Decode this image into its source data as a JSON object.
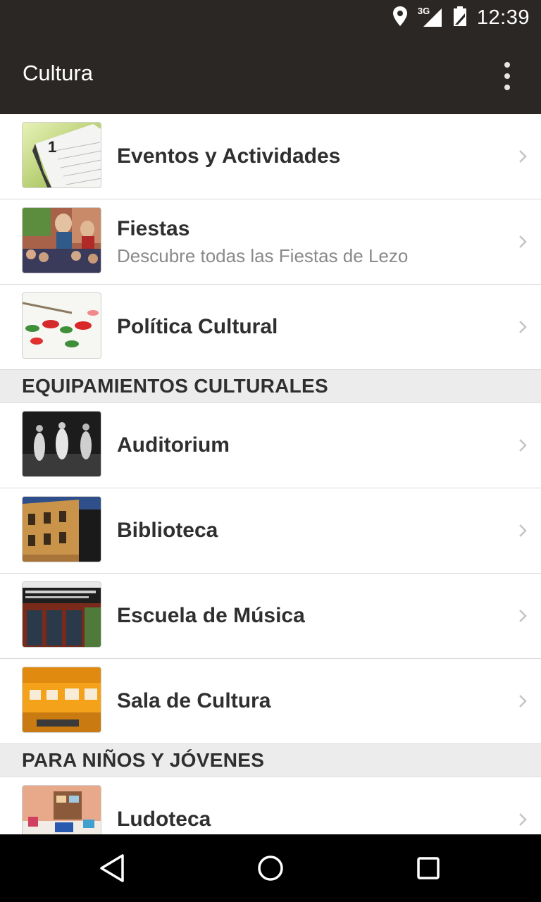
{
  "status_bar": {
    "time": "12:39",
    "network": "3G"
  },
  "app_bar": {
    "title": "Cultura",
    "menu_icon": "overflow-menu-icon"
  },
  "items": [
    {
      "title": "Eventos y Actividades",
      "subtitle": ""
    },
    {
      "title": "Fiestas",
      "subtitle": "Descubre todas las Fiestas de Lezo"
    },
    {
      "title": "Política Cultural",
      "subtitle": ""
    }
  ],
  "sections": [
    {
      "title": "EQUIPAMIENTOS CULTURALES",
      "items": [
        {
          "title": "Auditorium"
        },
        {
          "title": "Biblioteca"
        },
        {
          "title": "Escuela de Música"
        },
        {
          "title": "Sala de Cultura"
        }
      ]
    },
    {
      "title": "PARA NIÑOS Y JÓVENES",
      "items": [
        {
          "title": "Ludoteca"
        }
      ]
    }
  ],
  "nav_bar": {
    "back": "back-icon",
    "home": "home-icon",
    "recents": "recents-icon"
  },
  "colors": {
    "bar_background": "#2b2725",
    "section_background": "#ececec",
    "title_text": "#2f2f2f",
    "subtitle_text": "#8a8a8a"
  }
}
